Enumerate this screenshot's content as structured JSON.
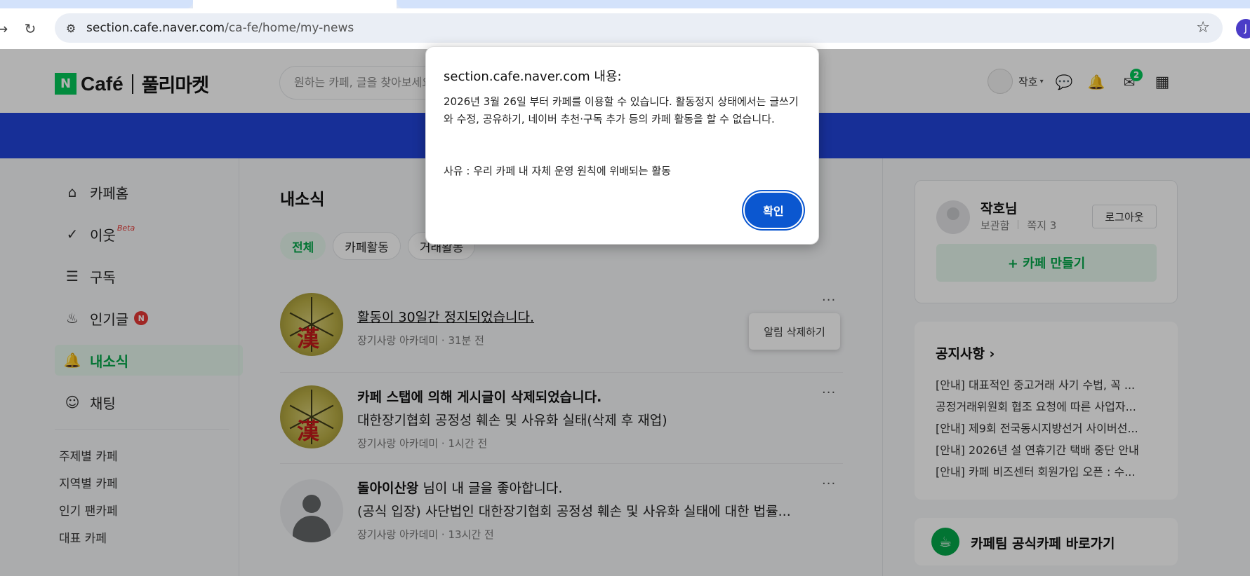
{
  "browser": {
    "url_host": "section.cafe.naver.com",
    "url_path": "/ca-fe/home/my-news",
    "profile_initial": "J"
  },
  "header": {
    "logo_n": "N",
    "logo_cafe": "Café",
    "logo_market": "풀리마켓",
    "search_placeholder": "원하는 카페, 글을 찾아보세요",
    "user_name": "작호",
    "mail_count": "2"
  },
  "sidebar": {
    "items": [
      {
        "label": "카페홈",
        "icon": "home-icon"
      },
      {
        "label": "이웃",
        "badge": "Beta",
        "icon": "check-badge-icon"
      },
      {
        "label": "구독",
        "icon": "document-icon"
      },
      {
        "label": "인기글",
        "badge": "N",
        "icon": "fire-icon"
      },
      {
        "label": "내소식",
        "icon": "bell-icon",
        "active": true
      },
      {
        "label": "채팅",
        "icon": "chat-icon"
      }
    ],
    "links": [
      "주제별 카페",
      "지역별 카페",
      "인기 팬카페",
      "대표 카페"
    ]
  },
  "main": {
    "title": "내소식",
    "chips": [
      "전체",
      "카페활동",
      "거래활동"
    ],
    "notifications": [
      {
        "title": "활동이 30일간 정지되었습니다.",
        "meta": "장기사랑 아카데미 · 31분 전"
      },
      {
        "title": "카페 스탭에 의해 게시글이 삭제되었습니다.",
        "desc": "대한장기협회 공정성 훼손 및 사유화 실태(삭제 후 재업)",
        "meta": "장기사랑 아카데미 · 1시간 전"
      },
      {
        "title_bold": "돌아이산왕",
        "title_rest": " 님이 내 글을 좋아합니다.",
        "desc": "(공식 입장) 사단법인 대한장기협회 공정성 훼손 및 사유화 실태에 대한 법률...",
        "meta": "장기사랑 아카데미 · 13시간 전"
      }
    ],
    "popmenu_label": "알림 삭제하기",
    "more_label": "···"
  },
  "right": {
    "name": "작호님",
    "storage": "보관함",
    "notes": "쪽지 3",
    "logout": "로그아웃",
    "make_cafe": "+ 카페 만들기",
    "notice_title": "공지사항 ›",
    "notices": [
      "[안내] 대표적인 중고거래 사기 수법, 꼭 ...",
      "공정거래위원회 협조 요청에 따른 사업자...",
      "[안내] 제9회 전국동시지방선거 사이버선...",
      "[안내] 2026년 설 연휴기간 택배 중단 안내",
      "[안내] 카페 비즈센터 회원가입 오픈 : 수..."
    ],
    "team_cafe": "카페팀 공식카페 바로가기"
  },
  "dialog": {
    "title": "section.cafe.naver.com 내용:",
    "message": "2026년 3월 26일 부터 카페를 이용할 수 있습니다. 활동정지 상태에서는 글쓰기와 수정, 공유하기, 네이버 추천·구독 추가 등의 카페 활동을 할 수 없습니다.",
    "reason": "사유 : 우리 카페 내 자체 운영 원칙에 위배되는 활동",
    "ok_label": "확인"
  },
  "colors": {
    "accent_green": "#03c75a",
    "banner_blue": "#2244d9",
    "dialog_button": "#0b57d0",
    "badge_red": "#e53935"
  }
}
